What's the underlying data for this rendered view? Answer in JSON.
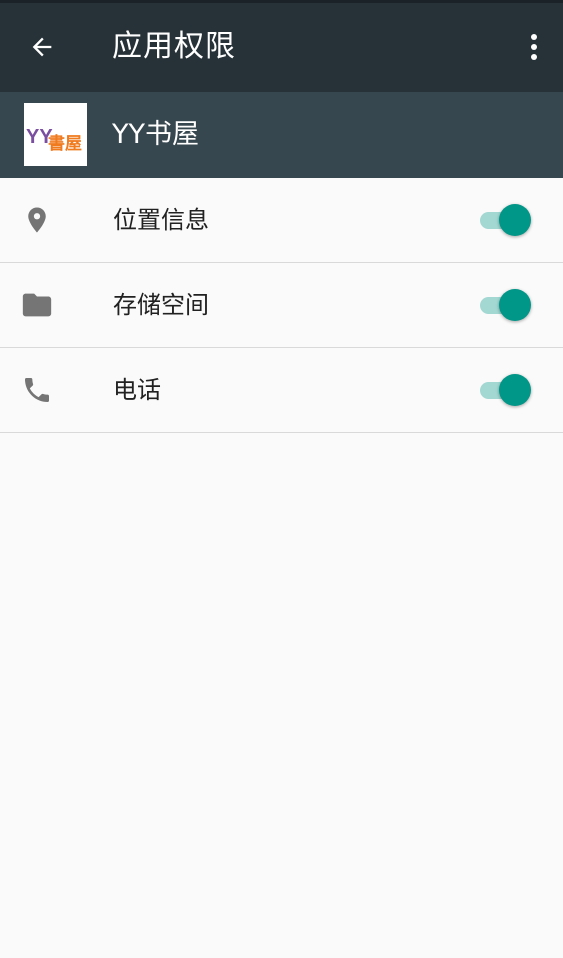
{
  "toolbar": {
    "title": "应用权限",
    "back_icon": "arrow-back-icon",
    "more_icon": "more-vert-icon"
  },
  "app": {
    "name": "YY书屋",
    "icon_text_latin": "YY",
    "icon_text_cjk": "書屋"
  },
  "permissions": [
    {
      "label": "位置信息",
      "icon": "location-pin-icon",
      "enabled": true
    },
    {
      "label": "存储空间",
      "icon": "folder-icon",
      "enabled": true
    },
    {
      "label": "电话",
      "icon": "phone-icon",
      "enabled": true
    }
  ],
  "colors": {
    "toolbar_bg": "#263238",
    "header_bg": "#37474f",
    "accent": "#009688",
    "icon_gray": "#757575",
    "background": "#fafafa"
  }
}
